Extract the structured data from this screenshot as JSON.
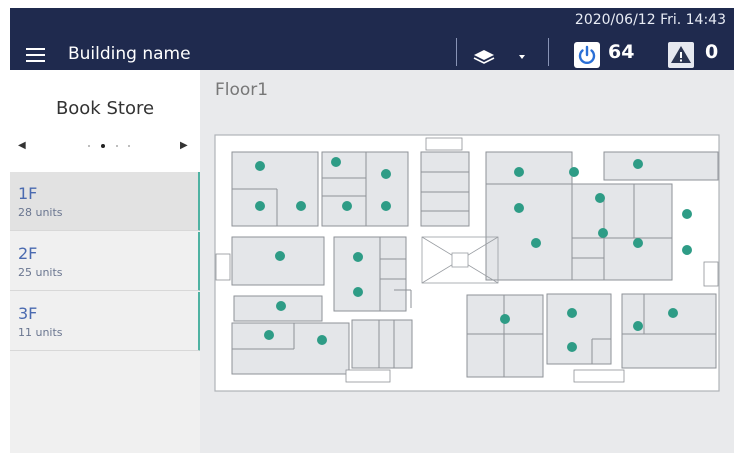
{
  "header": {
    "datetime": "2020/06/12 Fri. 14:43",
    "building_name": "Building name",
    "power_count": "64",
    "alert_count": "0",
    "icons": [
      "menu-icon",
      "layers-icon",
      "chevron-down-icon",
      "power-icon",
      "alert-icon"
    ]
  },
  "sidebar": {
    "store": {
      "name": "Book Store",
      "page_count": 4,
      "active_page": 2
    },
    "floors": [
      {
        "name": "1F",
        "units": "28 units",
        "selected": true
      },
      {
        "name": "2F",
        "units": "25 units",
        "selected": false
      },
      {
        "name": "3F",
        "units": "11 units",
        "selected": false
      }
    ]
  },
  "main": {
    "floor_title": "Floor1",
    "unit_count_on_map": 28
  },
  "colors": {
    "header_bg": "#1f2a4e",
    "accent_teal": "#2e9c86",
    "sidebar_stripe": "#4fb2a2",
    "power_blue": "#2a6fd6",
    "room_fill": "#e4e6e9"
  }
}
